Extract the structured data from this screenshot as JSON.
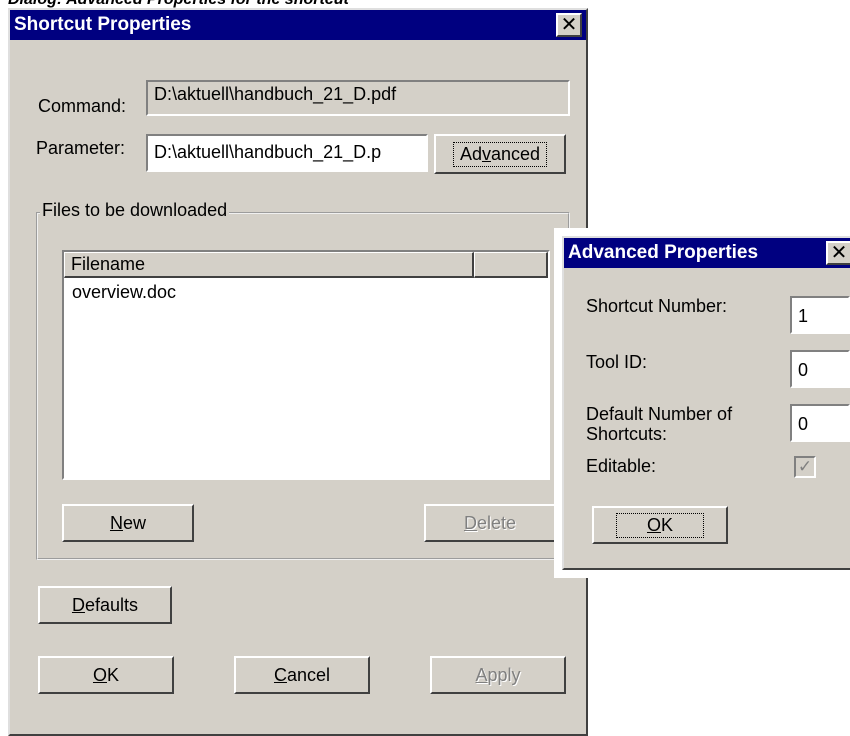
{
  "top_caption": "Dialog: Advanced Properties for the shortcut",
  "shortcut_dialog": {
    "title": "Shortcut Properties",
    "close_glyph": "✕",
    "command_label": "Command:",
    "command_value": "D:\\aktuell\\handbuch_21_D.pdf",
    "parameter_label": "Parameter:",
    "parameter_value": "D:\\aktuell\\handbuch_21_D.p",
    "advanced_button": {
      "pre": "Ad",
      "accel": "v",
      "post": "anced"
    },
    "files_group_label": "Files to be downloaded",
    "files_table": {
      "columns": [
        "Filename",
        ""
      ],
      "rows": [
        "overview.doc"
      ]
    },
    "new_button": {
      "accel": "N",
      "post": "ew"
    },
    "delete_button": {
      "accel": "D",
      "post": "elete"
    },
    "defaults_button": {
      "accel": "D",
      "post": "efaults"
    },
    "ok_button": {
      "accel": "O",
      "post": "K"
    },
    "cancel_button": {
      "accel": "C",
      "post": "ancel"
    },
    "apply_button": {
      "accel": "A",
      "post": "pply"
    }
  },
  "advanced_dialog": {
    "title": "Advanced Properties",
    "close_glyph": "✕",
    "shortcut_number_label": "Shortcut Number:",
    "shortcut_number_value": "1",
    "tool_id_label": "Tool ID:",
    "tool_id_value": "0",
    "default_number_label": "Default Number of Shortcuts:",
    "default_number_value": "0",
    "editable_label": "Editable:",
    "editable_checked": true,
    "editable_glyph": "✓",
    "ok_button": {
      "accel": "O",
      "post": "K"
    }
  },
  "colors": {
    "title_bar": "#000080",
    "face": "#d4d0c8",
    "disabled_text": "#808080"
  }
}
